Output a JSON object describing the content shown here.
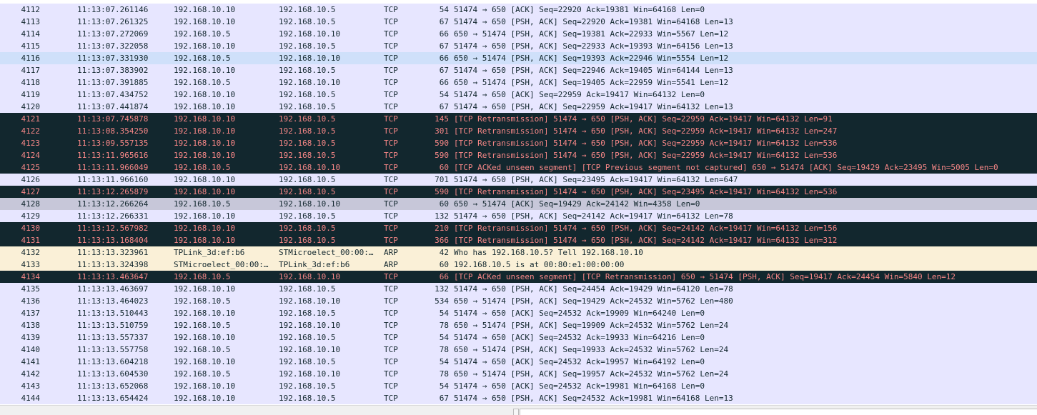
{
  "packets": [
    {
      "no": "4112",
      "time": "11:13:07.261146",
      "src": "192.168.10.10",
      "dst": "192.168.10.5",
      "proto": "TCP",
      "len": "54",
      "info": "51474 → 650 [ACK] Seq=22920 Ack=19381 Win=64168 Len=0",
      "style": "tcp"
    },
    {
      "no": "4113",
      "time": "11:13:07.261325",
      "src": "192.168.10.10",
      "dst": "192.168.10.5",
      "proto": "TCP",
      "len": "67",
      "info": "51474 → 650 [PSH, ACK] Seq=22920 Ack=19381 Win=64168 Len=13",
      "style": "tcp"
    },
    {
      "no": "4114",
      "time": "11:13:07.272069",
      "src": "192.168.10.5",
      "dst": "192.168.10.10",
      "proto": "TCP",
      "len": "66",
      "info": "650 → 51474 [PSH, ACK] Seq=19381 Ack=22933 Win=5567 Len=12",
      "style": "tcp"
    },
    {
      "no": "4115",
      "time": "11:13:07.322058",
      "src": "192.168.10.10",
      "dst": "192.168.10.5",
      "proto": "TCP",
      "len": "67",
      "info": "51474 → 650 [PSH, ACK] Seq=22933 Ack=19393 Win=64156 Len=13",
      "style": "tcp"
    },
    {
      "no": "4116",
      "time": "11:13:07.331930",
      "src": "192.168.10.5",
      "dst": "192.168.10.10",
      "proto": "TCP",
      "len": "66",
      "info": "650 → 51474 [PSH, ACK] Seq=19393 Ack=22946 Win=5554 Len=12",
      "style": "sel"
    },
    {
      "no": "4117",
      "time": "11:13:07.383902",
      "src": "192.168.10.10",
      "dst": "192.168.10.5",
      "proto": "TCP",
      "len": "67",
      "info": "51474 → 650 [PSH, ACK] Seq=22946 Ack=19405 Win=64144 Len=13",
      "style": "tcp"
    },
    {
      "no": "4118",
      "time": "11:13:07.391885",
      "src": "192.168.10.5",
      "dst": "192.168.10.10",
      "proto": "TCP",
      "len": "66",
      "info": "650 → 51474 [PSH, ACK] Seq=19405 Ack=22959 Win=5541 Len=12",
      "style": "tcp"
    },
    {
      "no": "4119",
      "time": "11:13:07.434752",
      "src": "192.168.10.10",
      "dst": "192.168.10.5",
      "proto": "TCP",
      "len": "54",
      "info": "51474 → 650 [ACK] Seq=22959 Ack=19417 Win=64132 Len=0",
      "style": "tcp"
    },
    {
      "no": "4120",
      "time": "11:13:07.441874",
      "src": "192.168.10.10",
      "dst": "192.168.10.5",
      "proto": "TCP",
      "len": "67",
      "info": "51474 → 650 [PSH, ACK] Seq=22959 Ack=19417 Win=64132 Len=13",
      "style": "tcp"
    },
    {
      "no": "4121",
      "time": "11:13:07.745878",
      "src": "192.168.10.10",
      "dst": "192.168.10.5",
      "proto": "TCP",
      "len": "145",
      "info": "[TCP Retransmission] 51474 → 650 [PSH, ACK] Seq=22959 Ack=19417 Win=64132 Len=91",
      "style": "dark"
    },
    {
      "no": "4122",
      "time": "11:13:08.354250",
      "src": "192.168.10.10",
      "dst": "192.168.10.5",
      "proto": "TCP",
      "len": "301",
      "info": "[TCP Retransmission] 51474 → 650 [PSH, ACK] Seq=22959 Ack=19417 Win=64132 Len=247",
      "style": "dark"
    },
    {
      "no": "4123",
      "time": "11:13:09.557135",
      "src": "192.168.10.10",
      "dst": "192.168.10.5",
      "proto": "TCP",
      "len": "590",
      "info": "[TCP Retransmission] 51474 → 650 [PSH, ACK] Seq=22959 Ack=19417 Win=64132 Len=536",
      "style": "dark"
    },
    {
      "no": "4124",
      "time": "11:13:11.965616",
      "src": "192.168.10.10",
      "dst": "192.168.10.5",
      "proto": "TCP",
      "len": "590",
      "info": "[TCP Retransmission] 51474 → 650 [PSH, ACK] Seq=22959 Ack=19417 Win=64132 Len=536",
      "style": "dark"
    },
    {
      "no": "4125",
      "time": "11:13:11.966049",
      "src": "192.168.10.5",
      "dst": "192.168.10.10",
      "proto": "TCP",
      "len": "60",
      "info": "[TCP ACKed unseen segment] [TCP Previous segment not captured] 650 → 51474 [ACK] Seq=19429 Ack=23495 Win=5005 Len=0",
      "style": "dark"
    },
    {
      "no": "4126",
      "time": "11:13:11.966160",
      "src": "192.168.10.10",
      "dst": "192.168.10.5",
      "proto": "TCP",
      "len": "701",
      "info": "51474 → 650 [PSH, ACK] Seq=23495 Ack=19417 Win=64132 Len=647",
      "style": "tcp"
    },
    {
      "no": "4127",
      "time": "11:13:12.265879",
      "src": "192.168.10.10",
      "dst": "192.168.10.5",
      "proto": "TCP",
      "len": "590",
      "info": "[TCP Retransmission] 51474 → 650 [PSH, ACK] Seq=23495 Ack=19417 Win=64132 Len=536",
      "style": "dark"
    },
    {
      "no": "4128",
      "time": "11:13:12.266264",
      "src": "192.168.10.5",
      "dst": "192.168.10.10",
      "proto": "TCP",
      "len": "60",
      "info": "650 → 51474 [ACK] Seq=19429 Ack=24142 Win=4358 Len=0",
      "style": "gray"
    },
    {
      "no": "4129",
      "time": "11:13:12.266331",
      "src": "192.168.10.10",
      "dst": "192.168.10.5",
      "proto": "TCP",
      "len": "132",
      "info": "51474 → 650 [PSH, ACK] Seq=24142 Ack=19417 Win=64132 Len=78",
      "style": "tcp"
    },
    {
      "no": "4130",
      "time": "11:13:12.567982",
      "src": "192.168.10.10",
      "dst": "192.168.10.5",
      "proto": "TCP",
      "len": "210",
      "info": "[TCP Retransmission] 51474 → 650 [PSH, ACK] Seq=24142 Ack=19417 Win=64132 Len=156",
      "style": "dark"
    },
    {
      "no": "4131",
      "time": "11:13:13.168404",
      "src": "192.168.10.10",
      "dst": "192.168.10.5",
      "proto": "TCP",
      "len": "366",
      "info": "[TCP Retransmission] 51474 → 650 [PSH, ACK] Seq=24142 Ack=19417 Win=64132 Len=312",
      "style": "dark"
    },
    {
      "no": "4132",
      "time": "11:13:13.323961",
      "src": "TPLink_3d:ef:b6",
      "dst": "STMicroelect_00:00:…",
      "proto": "ARP",
      "len": "42",
      "info": "Who has 192.168.10.5? Tell 192.168.10.10",
      "style": "arp"
    },
    {
      "no": "4133",
      "time": "11:13:13.324398",
      "src": "STMicroelect_00:00:…",
      "dst": "TPLink_3d:ef:b6",
      "proto": "ARP",
      "len": "60",
      "info": "192.168.10.5 is at 00:80:e1:00:00:00",
      "style": "arp"
    },
    {
      "no": "4134",
      "time": "11:13:13.463647",
      "src": "192.168.10.5",
      "dst": "192.168.10.10",
      "proto": "TCP",
      "len": "66",
      "info": "[TCP ACKed unseen segment] [TCP Retransmission] 650 → 51474 [PSH, ACK] Seq=19417 Ack=24454 Win=5840 Len=12",
      "style": "dark"
    },
    {
      "no": "4135",
      "time": "11:13:13.463697",
      "src": "192.168.10.10",
      "dst": "192.168.10.5",
      "proto": "TCP",
      "len": "132",
      "info": "51474 → 650 [PSH, ACK] Seq=24454 Ack=19429 Win=64120 Len=78",
      "style": "tcp"
    },
    {
      "no": "4136",
      "time": "11:13:13.464023",
      "src": "192.168.10.5",
      "dst": "192.168.10.10",
      "proto": "TCP",
      "len": "534",
      "info": "650 → 51474 [PSH, ACK] Seq=19429 Ack=24532 Win=5762 Len=480",
      "style": "tcp"
    },
    {
      "no": "4137",
      "time": "11:13:13.510443",
      "src": "192.168.10.10",
      "dst": "192.168.10.5",
      "proto": "TCP",
      "len": "54",
      "info": "51474 → 650 [ACK] Seq=24532 Ack=19909 Win=64240 Len=0",
      "style": "tcp"
    },
    {
      "no": "4138",
      "time": "11:13:13.510759",
      "src": "192.168.10.5",
      "dst": "192.168.10.10",
      "proto": "TCP",
      "len": "78",
      "info": "650 → 51474 [PSH, ACK] Seq=19909 Ack=24532 Win=5762 Len=24",
      "style": "tcp"
    },
    {
      "no": "4139",
      "time": "11:13:13.557337",
      "src": "192.168.10.10",
      "dst": "192.168.10.5",
      "proto": "TCP",
      "len": "54",
      "info": "51474 → 650 [ACK] Seq=24532 Ack=19933 Win=64216 Len=0",
      "style": "tcp"
    },
    {
      "no": "4140",
      "time": "11:13:13.557758",
      "src": "192.168.10.5",
      "dst": "192.168.10.10",
      "proto": "TCP",
      "len": "78",
      "info": "650 → 51474 [PSH, ACK] Seq=19933 Ack=24532 Win=5762 Len=24",
      "style": "tcp"
    },
    {
      "no": "4141",
      "time": "11:13:13.604218",
      "src": "192.168.10.10",
      "dst": "192.168.10.5",
      "proto": "TCP",
      "len": "54",
      "info": "51474 → 650 [ACK] Seq=24532 Ack=19957 Win=64192 Len=0",
      "style": "tcp"
    },
    {
      "no": "4142",
      "time": "11:13:13.604530",
      "src": "192.168.10.5",
      "dst": "192.168.10.10",
      "proto": "TCP",
      "len": "78",
      "info": "650 → 51474 [PSH, ACK] Seq=19957 Ack=24532 Win=5762 Len=24",
      "style": "tcp"
    },
    {
      "no": "4143",
      "time": "11:13:13.652068",
      "src": "192.168.10.10",
      "dst": "192.168.10.5",
      "proto": "TCP",
      "len": "54",
      "info": "51474 → 650 [ACK] Seq=24532 Ack=19981 Win=64168 Len=0",
      "style": "tcp"
    },
    {
      "no": "4144",
      "time": "11:13:13.654424",
      "src": "192.168.10.10",
      "dst": "192.168.10.5",
      "proto": "TCP",
      "len": "67",
      "info": "51474 → 650 [PSH, ACK] Seq=24532 Ack=19981 Win=64168 Len=13",
      "style": "tcp"
    }
  ],
  "colors": {
    "tcp_background": "#e7e6ff",
    "selected_background": "#cfe0fa",
    "arp_background": "#faf0d7",
    "bad_tcp_background": "#12272e",
    "bad_tcp_foreground": "#f78787",
    "gray_background": "#c7c7d9",
    "default_foreground": "#12272e"
  },
  "status": {
    "left_text": "",
    "right_text": ""
  }
}
